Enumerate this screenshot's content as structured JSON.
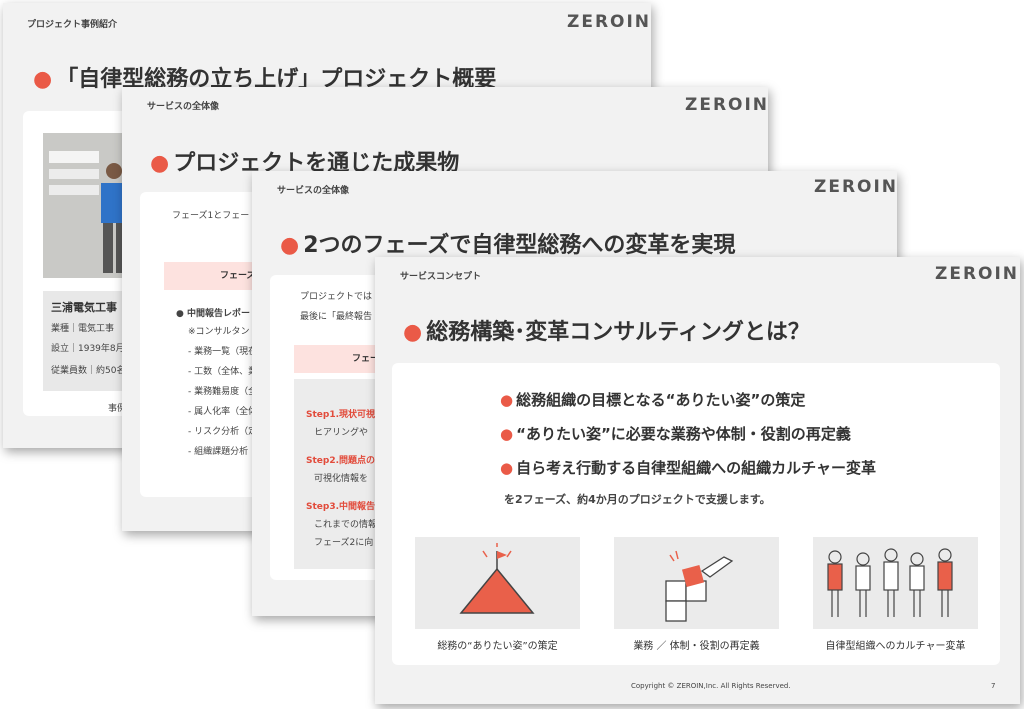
{
  "slide1": {
    "tag": "プロジェクト事例紹介",
    "logo": "ZEROIN",
    "title": "「自律型総務の立ち上げ」プロジェクト概要",
    "company": "三浦電気工事",
    "industry": "業種｜電気工事",
    "founded": "設立｜1939年8月",
    "employees": "従業員数｜約50名",
    "footer": "事例"
  },
  "slide2": {
    "tag": "サービスの全体像",
    "logo": "ZEROIN",
    "title": "プロジェクトを通じた成果物",
    "intro": "フェーズ1とフェー",
    "bar": "フェーズ",
    "bullet": "中間報告レポー",
    "note": "※コンサルタント",
    "items": [
      "業務一覧（現在",
      "工数（全体、業",
      "業務難易度（全",
      "属人化率（全体",
      "リスク分析（定",
      "組織課題分析（"
    ]
  },
  "slide3": {
    "tag": "サービスの全体像",
    "logo": "ZEROIN",
    "title": "2つのフェーズで自律型総務への変革を実現",
    "line1": "プロジェクトでは",
    "line2": "最後に「最終報告",
    "bar": "フェー",
    "steps": [
      {
        "head": "Step1.現状可視",
        "body": "ヒアリングや"
      },
      {
        "head": "Step2.問題点の",
        "body": "可視化情報を"
      },
      {
        "head": "Step3.中間報告",
        "body": "これまでの情報",
        "body2": "フェーズ2に向"
      }
    ]
  },
  "slide4": {
    "tag": "サービスコンセプト",
    "logo": "ZEROIN",
    "title": "総務構築･変革コンサルティングとは？",
    "bullets": [
      "総務組織の目標となる“ありたい姿”の策定",
      "“ありたい姿”に必要な業務や体制・役割の再定義",
      "自ら考え行動する自律型組織への組織カルチャー変革"
    ],
    "summary": "を2フェーズ、約4か月のプロジェクトで支援します。",
    "captions": [
      "総務の“ありたい姿”の策定",
      "業務 ／ 体制・役割の再定義",
      "自律型組織へのカルチャー変革"
    ],
    "copyright": "Copyright © ZEROIN,Inc. All Rights Reserved.",
    "page": "7",
    "accent": "#ea5a47"
  }
}
